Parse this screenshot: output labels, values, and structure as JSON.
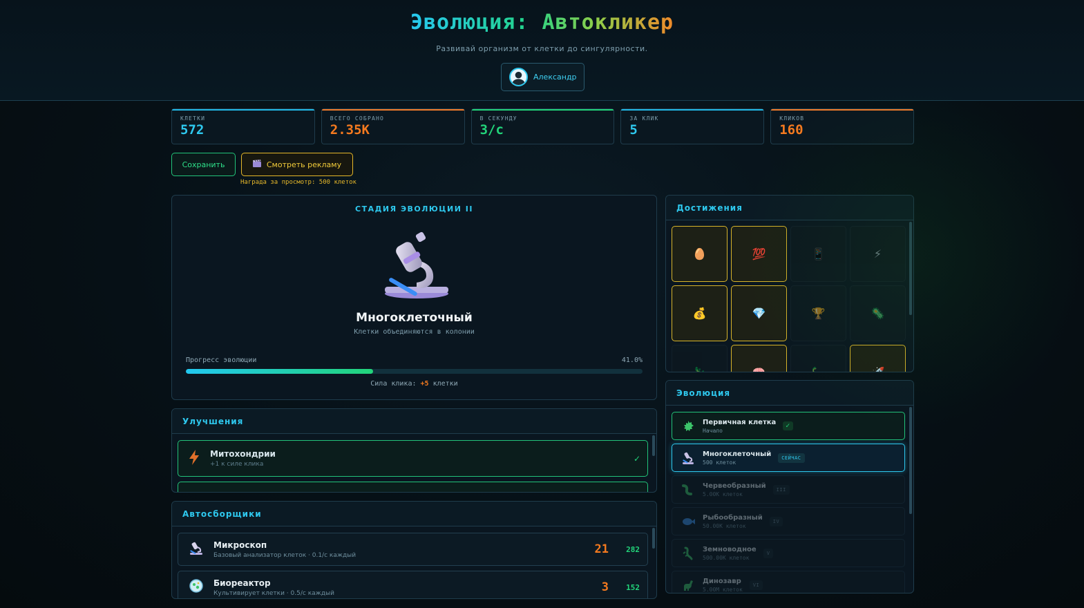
{
  "header": {
    "title": "Эволюция: Автокликер",
    "subtitle": "Развивай организм от клетки до сингулярности.",
    "user_name": "Александр"
  },
  "stats": [
    {
      "label": "Клетки",
      "value": "572",
      "color": "#2ec8ee"
    },
    {
      "label": "Всего собрано",
      "value": "2.35K",
      "color": "#f57a1f"
    },
    {
      "label": "В секунду",
      "value": "3/с",
      "color": "#22d47a"
    },
    {
      "label": "За клик",
      "value": "5",
      "color": "#2ec8ee"
    },
    {
      "label": "Кликов",
      "value": "160",
      "color": "#f57a1f"
    }
  ],
  "actions": {
    "save_label": "Сохранить",
    "ad_label": "Смотреть рекламу",
    "ad_note": "Награда за просмотр: 500 клеток"
  },
  "stage": {
    "label": "СТАДИЯ ЭВОЛЮЦИИ II",
    "name": "Многоклеточный",
    "description": "Клетки объединяются в колонии",
    "progress_label": "Прогресс эволюции",
    "progress_text": "41.0%",
    "progress": 0.41,
    "click_power_prefix": "Сила клика: ",
    "click_power_value": "+5",
    "click_power_suffix": " клетки"
  },
  "upgrades": {
    "title": "Улучшения",
    "items": [
      {
        "name": "Митохондрии",
        "desc": "+1 к силе клика",
        "icon": "lightning-icon",
        "bought": true
      }
    ]
  },
  "auto": {
    "title": "Автосборщики",
    "items": [
      {
        "name": "Микроскоп",
        "desc": "Базовый анализатор клеток · 0.1/с каждый",
        "count": "21",
        "cost": "282",
        "icon": "microscope-icon"
      },
      {
        "name": "Биореактор",
        "desc": "Культивирует клетки · 0.5/с каждый",
        "count": "3",
        "cost": "152",
        "icon": "bioreactor-icon"
      }
    ]
  },
  "achievements": {
    "title": "Достижения",
    "items": [
      {
        "icon": "🥚",
        "unlocked": true
      },
      {
        "icon": "💯",
        "unlocked": true
      },
      {
        "icon": "📱",
        "unlocked": false
      },
      {
        "icon": "⚡",
        "unlocked": false
      },
      {
        "icon": "💰",
        "unlocked": true
      },
      {
        "icon": "💎",
        "unlocked": true
      },
      {
        "icon": "🏆",
        "unlocked": false
      },
      {
        "icon": "🦠",
        "unlocked": false
      },
      {
        "icon": "🦎",
        "unlocked": false
      },
      {
        "icon": "🧠",
        "unlocked": true
      },
      {
        "icon": "🦕",
        "unlocked": false
      },
      {
        "icon": "🚀",
        "unlocked": true
      }
    ]
  },
  "evolution": {
    "title": "Эволюция",
    "items": [
      {
        "name": "Первичная клетка",
        "sub": "Начало",
        "badge": "✓",
        "state": "done",
        "icon": "cell-icon",
        "color": "#3cc46a"
      },
      {
        "name": "Многоклеточный",
        "sub": "500 клеток",
        "badge": "СЕЙЧАС",
        "state": "cur",
        "icon": "microscope-icon",
        "color": "#c9c2e6"
      },
      {
        "name": "Червеобразный",
        "sub": "5.00K клеток",
        "badge": "III",
        "state": "lock",
        "icon": "worm-icon",
        "color": "#3cc46a"
      },
      {
        "name": "Рыбообразный",
        "sub": "50.00K клеток",
        "badge": "IV",
        "state": "lock",
        "icon": "fish-icon",
        "color": "#3a8ee6"
      },
      {
        "name": "Земноводное",
        "sub": "500.00K клеток",
        "badge": "V",
        "state": "lock",
        "icon": "lizard-icon",
        "color": "#3cc46a"
      },
      {
        "name": "Динозавр",
        "sub": "5.00M клеток",
        "badge": "VI",
        "state": "lock",
        "icon": "dinosaur-icon",
        "color": "#3cc46a"
      }
    ]
  }
}
